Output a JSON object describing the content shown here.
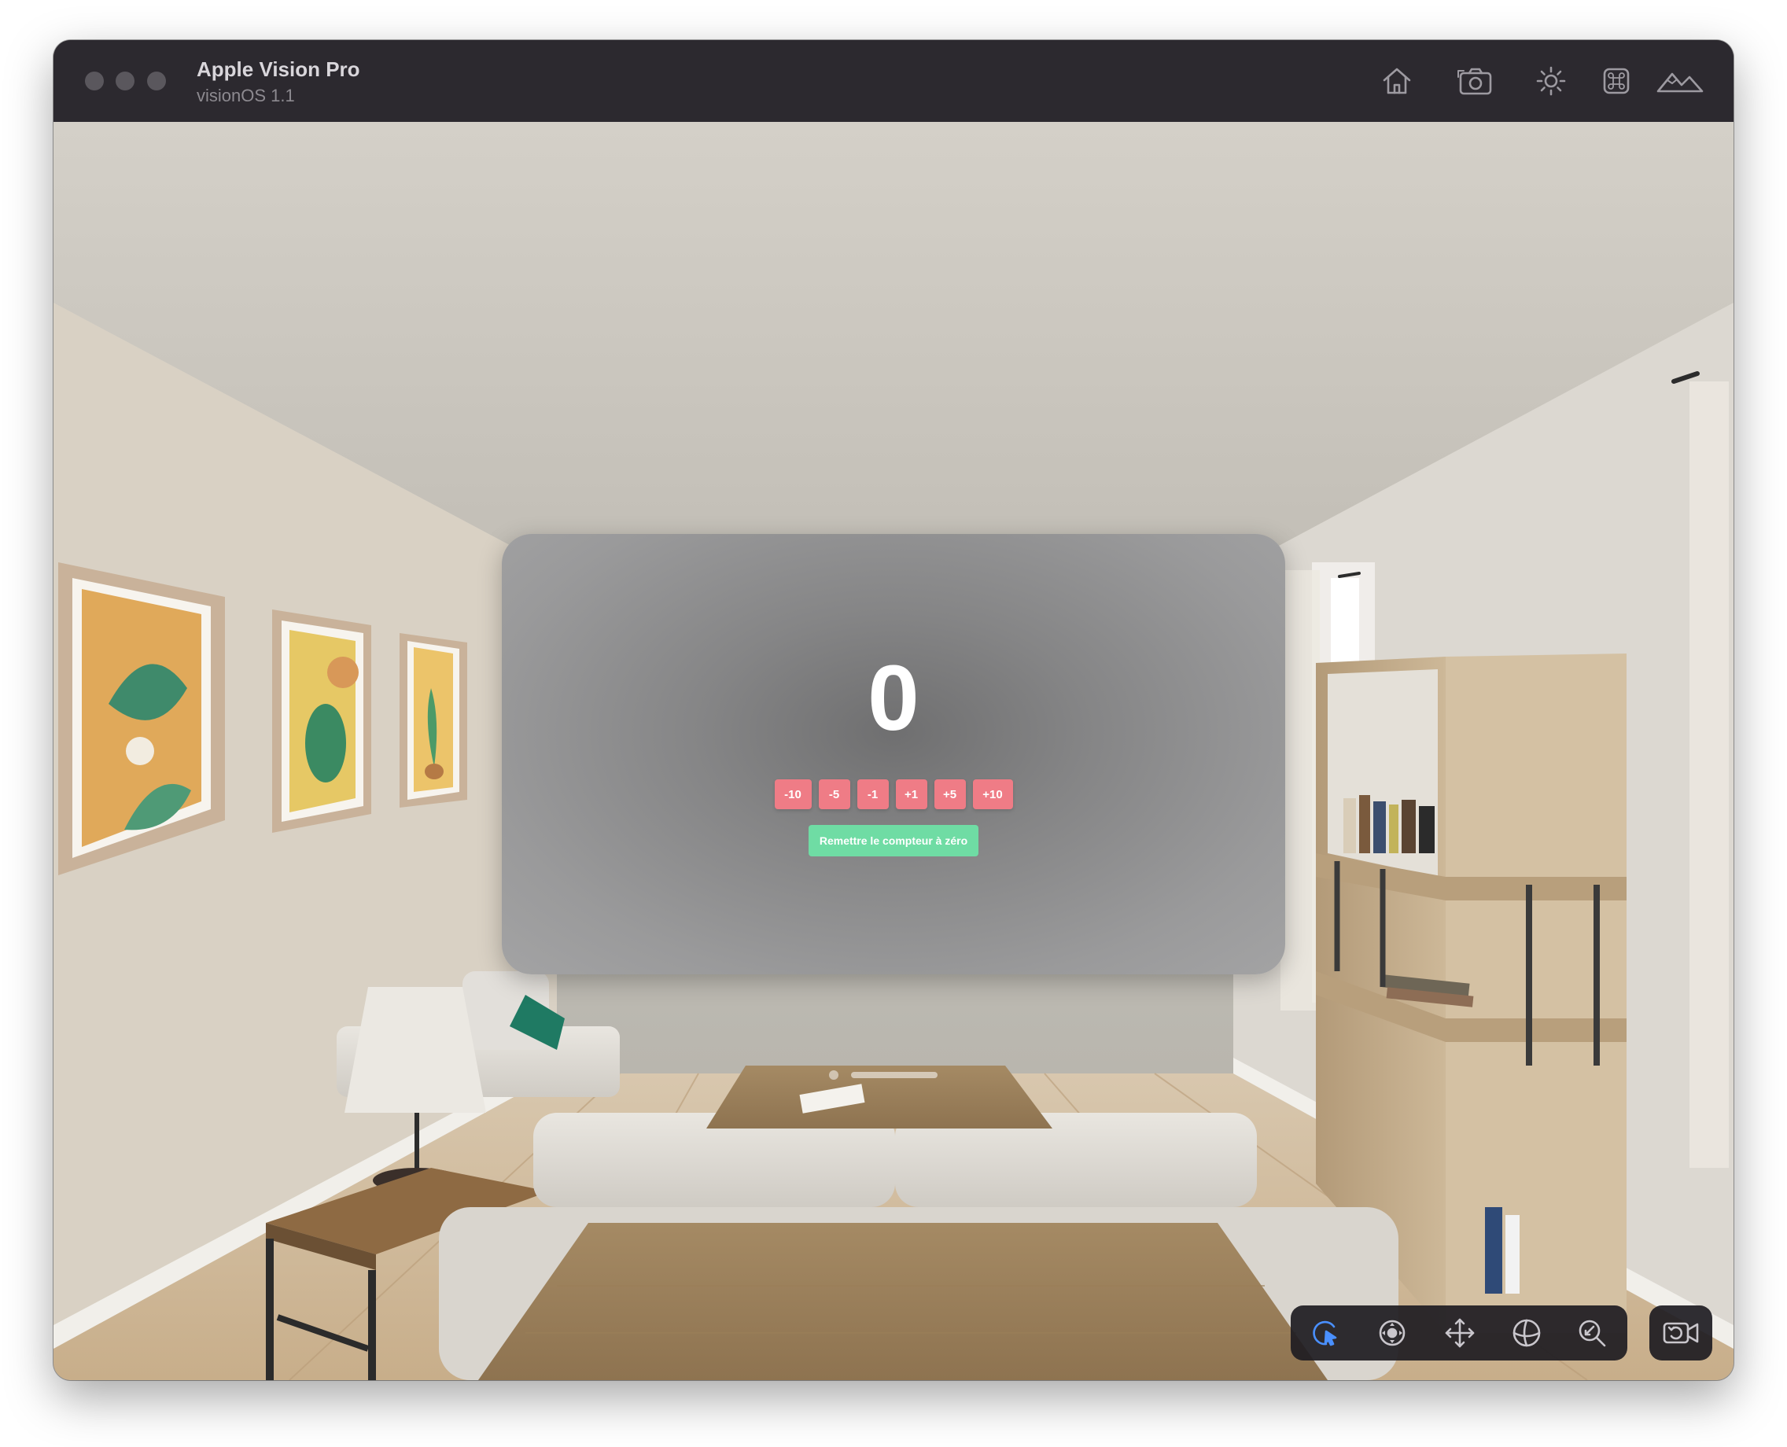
{
  "window": {
    "title": "Apple Vision Pro",
    "subtitle": "visionOS 1.1"
  },
  "titlebar_icons": [
    "home-icon",
    "screenshot-icon",
    "brightness-icon",
    "command-icon",
    "environment-mountains-icon"
  ],
  "app": {
    "counter_value": "0",
    "buttons": [
      "-10",
      "-5",
      "-1",
      "+1",
      "+5",
      "+10"
    ],
    "reset_label": "Remettre le compteur à zéro",
    "step_color": "#ef7c86",
    "reset_color": "#6fdca4"
  },
  "toolbar": {
    "tools": [
      "select-pointer-icon",
      "look-around-icon",
      "pan-icon",
      "orbit-icon",
      "zoom-icon"
    ],
    "active_tool": "select-pointer-icon",
    "camera_button": "reset-camera-icon",
    "active_color": "#4a90ff"
  }
}
